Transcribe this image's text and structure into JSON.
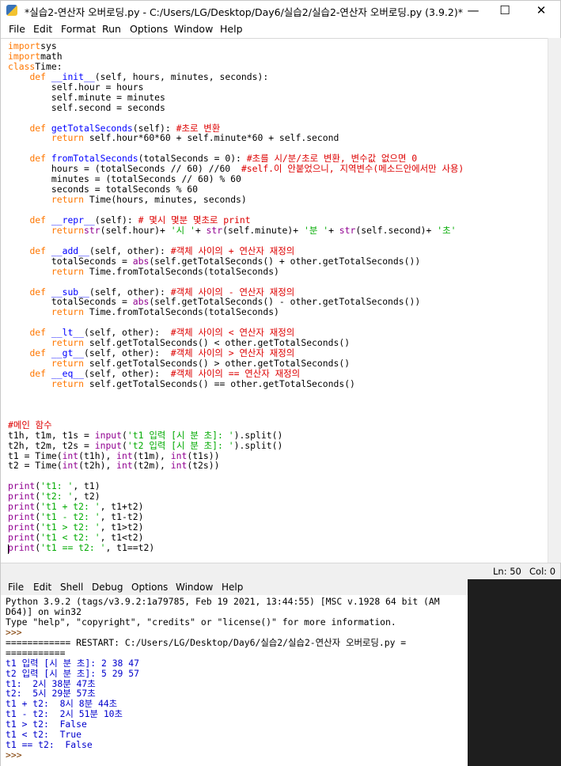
{
  "editor": {
    "title": "*실습2-연산자 오버로딩.py - C:/Users/LG/Desktop/Day6/실습2/실습2-연산자 오버로딩.py (3.9.2)*",
    "window_controls": {
      "minimize": "—",
      "maximize": "☐",
      "close": "✕"
    },
    "menu": [
      "File",
      "Edit",
      "Format",
      "Run",
      "Options",
      "Window",
      "Help"
    ],
    "status": {
      "line": "Ln: 50",
      "col": "Col: 0"
    },
    "code_lines": [
      [
        [
          "kw",
          "import"
        ],
        [
          "",
          "sys"
        ]
      ],
      [
        [
          "kw",
          "import"
        ],
        [
          "",
          "math"
        ]
      ],
      [
        [
          "kw",
          "class"
        ],
        [
          "",
          "Time:"
        ]
      ],
      [
        [
          "",
          "    "
        ],
        [
          "kw",
          "def"
        ],
        [
          "",
          ""
        ],
        [
          "fn",
          "__init__"
        ],
        [
          "",
          "(self, hours, minutes, seconds):"
        ]
      ],
      [
        [
          "",
          "        self.hour = hours"
        ]
      ],
      [
        [
          "",
          "        self.minute = minutes"
        ]
      ],
      [
        [
          "",
          "        self.second = seconds"
        ]
      ],
      [
        [
          "",
          ""
        ]
      ],
      [
        [
          "",
          "    "
        ],
        [
          "kw",
          "def"
        ],
        [
          "",
          ""
        ],
        [
          "fn",
          "getTotalSeconds"
        ],
        [
          "",
          "(self): "
        ],
        [
          "cm",
          "#초로 변환"
        ]
      ],
      [
        [
          "",
          "        "
        ],
        [
          "kw",
          "return"
        ],
        [
          "",
          " self.hour*60*60 + self.minute*60 + self.second"
        ]
      ],
      [
        [
          "",
          ""
        ]
      ],
      [
        [
          "",
          "    "
        ],
        [
          "kw",
          "def"
        ],
        [
          "",
          ""
        ],
        [
          "fn",
          "fromTotalSeconds"
        ],
        [
          "",
          "(totalSeconds = 0): "
        ],
        [
          "cm",
          "#초를 시/분/초로 변환, 변수값 없으면 0"
        ]
      ],
      [
        [
          "",
          "        hours = (totalSeconds // 60) //60  "
        ],
        [
          "cm",
          "#self.이 안붙었으니, 지역변수(메소드안에서만 사용)"
        ]
      ],
      [
        [
          "",
          "        minutes = (totalSeconds // 60) % 60"
        ]
      ],
      [
        [
          "",
          "        seconds = totalSeconds % 60"
        ]
      ],
      [
        [
          "",
          "        "
        ],
        [
          "kw",
          "return"
        ],
        [
          "",
          " Time(hours, minutes, seconds)"
        ]
      ],
      [
        [
          "",
          ""
        ]
      ],
      [
        [
          "",
          "    "
        ],
        [
          "kw",
          "def"
        ],
        [
          "",
          ""
        ],
        [
          "fn",
          "__repr__"
        ],
        [
          "",
          "(self): "
        ],
        [
          "cm",
          "# 몇시 몇분 몇초로 print"
        ]
      ],
      [
        [
          "",
          "        "
        ],
        [
          "kw",
          "return"
        ],
        [
          "",
          ""
        ],
        [
          "bi",
          "str"
        ],
        [
          "",
          "(self.hour)+ "
        ],
        [
          "st",
          "'시 '"
        ],
        [
          "",
          "+ "
        ],
        [
          "bi",
          "str"
        ],
        [
          "",
          "(self.minute)+ "
        ],
        [
          "st",
          "'분 '"
        ],
        [
          "",
          "+ "
        ],
        [
          "bi",
          "str"
        ],
        [
          "",
          "(self.second)+ "
        ],
        [
          "st",
          "'초'"
        ]
      ],
      [
        [
          "",
          ""
        ]
      ],
      [
        [
          "",
          "    "
        ],
        [
          "kw",
          "def"
        ],
        [
          "",
          ""
        ],
        [
          "fn",
          "__add__"
        ],
        [
          "",
          "(self, other): "
        ],
        [
          "cm",
          "#객체 사이의 + 연산자 재정의"
        ]
      ],
      [
        [
          "",
          "        totalSeconds = "
        ],
        [
          "bi",
          "abs"
        ],
        [
          "",
          "(self.getTotalSeconds() + other.getTotalSeconds())"
        ]
      ],
      [
        [
          "",
          "        "
        ],
        [
          "kw",
          "return"
        ],
        [
          "",
          " Time.fromTotalSeconds(totalSeconds)"
        ]
      ],
      [
        [
          "",
          ""
        ]
      ],
      [
        [
          "",
          "    "
        ],
        [
          "kw",
          "def"
        ],
        [
          "",
          ""
        ],
        [
          "fn",
          "__sub__"
        ],
        [
          "",
          "(self, other): "
        ],
        [
          "cm",
          "#객체 사이의 - 연산자 재정의"
        ]
      ],
      [
        [
          "",
          "        totalSeconds = "
        ],
        [
          "bi",
          "abs"
        ],
        [
          "",
          "(self.getTotalSeconds() - other.getTotalSeconds())"
        ]
      ],
      [
        [
          "",
          "        "
        ],
        [
          "kw",
          "return"
        ],
        [
          "",
          " Time.fromTotalSeconds(totalSeconds)"
        ]
      ],
      [
        [
          "",
          ""
        ]
      ],
      [
        [
          "",
          "    "
        ],
        [
          "kw",
          "def"
        ],
        [
          "",
          ""
        ],
        [
          "fn",
          "__lt__"
        ],
        [
          "",
          "(self, other):  "
        ],
        [
          "cm",
          "#객체 사이의 < 연산자 재정의"
        ]
      ],
      [
        [
          "",
          "        "
        ],
        [
          "kw",
          "return"
        ],
        [
          "",
          " self.getTotalSeconds() < other.getTotalSeconds()"
        ]
      ],
      [
        [
          "",
          "    "
        ],
        [
          "kw",
          "def"
        ],
        [
          "",
          ""
        ],
        [
          "fn",
          "__gt__"
        ],
        [
          "",
          "(self, other):  "
        ],
        [
          "cm",
          "#객체 사이의 > 연산자 재정의"
        ]
      ],
      [
        [
          "",
          "        "
        ],
        [
          "kw",
          "return"
        ],
        [
          "",
          " self.getTotalSeconds() > other.getTotalSeconds()"
        ]
      ],
      [
        [
          "",
          "    "
        ],
        [
          "kw",
          "def"
        ],
        [
          "",
          ""
        ],
        [
          "fn",
          "__eq__"
        ],
        [
          "",
          "(self, other):  "
        ],
        [
          "cm",
          "#객체 사이의 == 연산자 재정의"
        ]
      ],
      [
        [
          "",
          "        "
        ],
        [
          "kw",
          "return"
        ],
        [
          "",
          " self.getTotalSeconds() == other.getTotalSeconds()"
        ]
      ],
      [
        [
          "",
          ""
        ]
      ],
      [
        [
          "",
          ""
        ]
      ],
      [
        [
          "",
          ""
        ]
      ],
      [
        [
          "cm",
          "#메인 함수"
        ]
      ],
      [
        [
          "",
          "t1h, t1m, t1s = "
        ],
        [
          "bi",
          "input"
        ],
        [
          "",
          "("
        ],
        [
          "st",
          "'t1 입력 [시 분 초]: '"
        ],
        [
          "",
          ").split()"
        ]
      ],
      [
        [
          "",
          "t2h, t2m, t2s = "
        ],
        [
          "bi",
          "input"
        ],
        [
          "",
          "("
        ],
        [
          "st",
          "'t2 입력 [시 분 초]: '"
        ],
        [
          "",
          ").split()"
        ]
      ],
      [
        [
          "",
          "t1 = Time("
        ],
        [
          "bi",
          "int"
        ],
        [
          "",
          "(t1h), "
        ],
        [
          "bi",
          "int"
        ],
        [
          "",
          "(t1m), "
        ],
        [
          "bi",
          "int"
        ],
        [
          "",
          "(t1s))"
        ]
      ],
      [
        [
          "",
          "t2 = Time("
        ],
        [
          "bi",
          "int"
        ],
        [
          "",
          "(t2h), "
        ],
        [
          "bi",
          "int"
        ],
        [
          "",
          "(t2m), "
        ],
        [
          "bi",
          "int"
        ],
        [
          "",
          "(t2s))"
        ]
      ],
      [
        [
          "",
          ""
        ]
      ],
      [
        [
          "bi",
          "print"
        ],
        [
          "",
          "("
        ],
        [
          "st",
          "'t1: '"
        ],
        [
          "",
          ", t1)"
        ]
      ],
      [
        [
          "bi",
          "print"
        ],
        [
          "",
          "("
        ],
        [
          "st",
          "'t2: '"
        ],
        [
          "",
          ", t2)"
        ]
      ],
      [
        [
          "bi",
          "print"
        ],
        [
          "",
          "("
        ],
        [
          "st",
          "'t1 + t2: '"
        ],
        [
          "",
          ", t1+t2)"
        ]
      ],
      [
        [
          "bi",
          "print"
        ],
        [
          "",
          "("
        ],
        [
          "st",
          "'t1 - t2: '"
        ],
        [
          "",
          ", t1-t2)"
        ]
      ],
      [
        [
          "bi",
          "print"
        ],
        [
          "",
          "("
        ],
        [
          "st",
          "'t1 > t2: '"
        ],
        [
          "",
          ", t1>t2)"
        ]
      ],
      [
        [
          "bi",
          "print"
        ],
        [
          "",
          "("
        ],
        [
          "st",
          "'t1 < t2: '"
        ],
        [
          "",
          ", t1<t2)"
        ]
      ],
      [
        [
          "bi",
          "print"
        ],
        [
          "",
          "("
        ],
        [
          "st",
          "'t1 == t2: '"
        ],
        [
          "",
          ", t1==t2)"
        ]
      ]
    ]
  },
  "shell": {
    "menu": [
      "File",
      "Edit",
      "Shell",
      "Debug",
      "Options",
      "Window",
      "Help"
    ],
    "lines": [
      [
        [
          "o-banner",
          "Python 3.9.2 (tags/v3.9.2:1a79785, Feb 19 2021, 13:44:55) [MSC v.1928 64 bit (AM"
        ]
      ],
      [
        [
          "o-banner",
          "D64)] on win32"
        ]
      ],
      [
        [
          "o-banner",
          "Type \"help\", \"copyright\", \"credits\" or \"license()\" for more information."
        ]
      ],
      [
        [
          "o-prompt",
          ">>> "
        ]
      ],
      [
        [
          "o-restart",
          "============ RESTART: C:/Users/LG/Desktop/Day6/실습2/실습2-연산자 오버로딩.py ="
        ]
      ],
      [
        [
          "o-restart",
          "==========="
        ]
      ],
      [
        [
          "o-out",
          "t1 입력 [시 분 초]: "
        ],
        [
          "o-in",
          "2 38 47"
        ]
      ],
      [
        [
          "o-out",
          "t2 입력 [시 분 초]: "
        ],
        [
          "o-in",
          "5 29 57"
        ]
      ],
      [
        [
          "o-out",
          "t1:  2시 38분 47초"
        ]
      ],
      [
        [
          "o-out",
          "t2:  5시 29분 57초"
        ]
      ],
      [
        [
          "o-out",
          "t1 + t2:  8시 8분 44초"
        ]
      ],
      [
        [
          "o-out",
          "t1 - t2:  2시 51분 10초"
        ]
      ],
      [
        [
          "o-out",
          "t1 > t2:  False"
        ]
      ],
      [
        [
          "o-out",
          "t1 < t2:  True"
        ]
      ],
      [
        [
          "o-out",
          "t1 == t2:  False"
        ]
      ],
      [
        [
          "o-prompt",
          ">>> "
        ]
      ]
    ]
  }
}
